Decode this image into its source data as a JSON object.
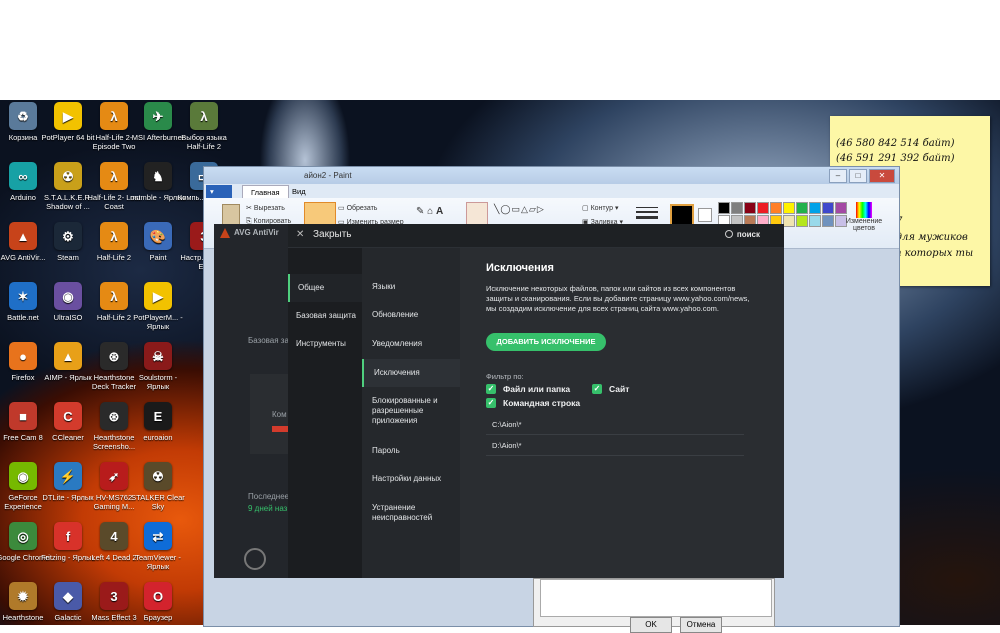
{
  "desktop": {
    "col1": [
      {
        "label": "Корзина",
        "icon": "recycle-bin-icon",
        "color": "#5a7a9a",
        "glyph": "♻"
      },
      {
        "label": "Arduino",
        "icon": "arduino-icon",
        "color": "#17a1a5",
        "glyph": "∞"
      },
      {
        "label": "AVG AntiVir...",
        "icon": "avg-icon",
        "color": "#c7431a",
        "glyph": "▲"
      },
      {
        "label": "Battle.net",
        "icon": "battlenet-icon",
        "color": "#1f6fc7",
        "glyph": "✶"
      },
      {
        "label": "Firefox",
        "icon": "firefox-icon",
        "color": "#e8731c",
        "glyph": "●"
      },
      {
        "label": "Free Cam 8",
        "icon": "freecam-icon",
        "color": "#c0392b",
        "glyph": "■"
      },
      {
        "label": "GeForce Experience",
        "icon": "geforce-icon",
        "color": "#76b900",
        "glyph": "◉"
      },
      {
        "label": "Google Chrome",
        "icon": "chrome-icon",
        "color": "#3c8a3c",
        "glyph": "◎"
      },
      {
        "label": "Hearthstone",
        "icon": "hearthstone-icon",
        "color": "#b07a2a",
        "glyph": "✹"
      }
    ],
    "col2": [
      {
        "label": "PotPlayer 64 bit",
        "icon": "potplayer-icon",
        "color": "#f2c200",
        "glyph": "▶"
      },
      {
        "label": "S.T.A.L.K.E.R. Shadow of ...",
        "icon": "stalker-icon",
        "color": "#c9a01a",
        "glyph": "☢"
      },
      {
        "label": "Steam",
        "icon": "steam-icon",
        "color": "#1b2838",
        "glyph": "⚙"
      },
      {
        "label": "UltraISO",
        "icon": "ultraiso-icon",
        "color": "#6a4fa0",
        "glyph": "◉"
      },
      {
        "label": "AIMP - Ярлык",
        "icon": "aimp-icon",
        "color": "#e8a018",
        "glyph": "▲"
      },
      {
        "label": "CCleaner",
        "icon": "ccleaner-icon",
        "color": "#d33b2c",
        "glyph": "C"
      },
      {
        "label": "DTLite - Ярлык",
        "icon": "dtlite-icon",
        "color": "#2a7ac2",
        "glyph": "⚡"
      },
      {
        "label": "Fritzing - Ярлык",
        "icon": "fritzing-icon",
        "color": "#d8322a",
        "glyph": "f"
      },
      {
        "label": "Galactic",
        "icon": "galactic-icon",
        "color": "#4a5aa8",
        "glyph": "◆"
      }
    ],
    "col3": [
      {
        "label": "Half-Life 2- Episode Two",
        "icon": "halflife-icon",
        "color": "#e58a14",
        "glyph": "λ"
      },
      {
        "label": "Half-Life 2- Lost Coast",
        "icon": "halflife-icon",
        "color": "#e58a14",
        "glyph": "λ"
      },
      {
        "label": "Half-Life 2",
        "icon": "halflife-icon",
        "color": "#e58a14",
        "glyph": "λ"
      },
      {
        "label": "Half-Life 2",
        "icon": "halflife-icon",
        "color": "#e58a14",
        "glyph": "λ"
      },
      {
        "label": "Hearthstone Deck Tracker",
        "icon": "deck-tracker-icon",
        "color": "#2a2a2a",
        "glyph": "⊛"
      },
      {
        "label": "Hearthstone Screensho...",
        "icon": "screenshot-icon",
        "color": "#2a2a2a",
        "glyph": "⊛"
      },
      {
        "label": "HV-MS762 Gaming M...",
        "icon": "mouse-icon",
        "color": "#b81c1c",
        "glyph": "➶"
      },
      {
        "label": "Left 4 Dead 2",
        "icon": "left4dead-icon",
        "color": "#5a4a2a",
        "glyph": "4"
      },
      {
        "label": "Mass Effect 3",
        "icon": "masseffect-icon",
        "color": "#9a1a1a",
        "glyph": "3"
      }
    ],
    "col4": [
      {
        "label": "MSI Afterburner",
        "icon": "afterburner-icon",
        "color": "#2a8a4a",
        "glyph": "✈"
      },
      {
        "label": "mumble - Ярлык",
        "icon": "mumble-icon",
        "color": "#222222",
        "glyph": "♞"
      },
      {
        "label": "Paint",
        "icon": "paint-icon",
        "color": "#3a6ab8",
        "glyph": "🎨"
      },
      {
        "label": "PotPlayerM... - Ярлык",
        "icon": "potplayer-icon",
        "color": "#f2c200",
        "glyph": "▶"
      },
      {
        "label": "Soulstorm - Ярлык",
        "icon": "soulstorm-icon",
        "color": "#8a1a1a",
        "glyph": "☠"
      },
      {
        "label": "euroaion",
        "icon": "euroaion-icon",
        "color": "#1a1a1a",
        "glyph": "E"
      },
      {
        "label": "STALKER Clear Sky",
        "icon": "stalker-icon",
        "color": "#5a4a2a",
        "glyph": "☢"
      },
      {
        "label": "TeamViewer - Ярлык",
        "icon": "teamviewer-icon",
        "color": "#0e6cd8",
        "glyph": "⇄"
      },
      {
        "label": "Браузер",
        "icon": "opera-icon",
        "color": "#d3232d",
        "glyph": "O"
      }
    ],
    "col5": [
      {
        "label": "Выбор языка Half-Life 2",
        "icon": "halflife-lang-icon",
        "color": "#5a7a3a",
        "glyph": "λ"
      },
      {
        "label": "Компь... Ярлык",
        "icon": "computer-icon",
        "color": "#3a6a9a",
        "glyph": "▭"
      },
      {
        "label": "Настр... Mass E...",
        "icon": "masseffect-config-icon",
        "color": "#9a1a1a",
        "glyph": "3"
      }
    ],
    "taskbar_over": [
      {
        "label": "Google Chrome",
        "icon": "chrome-icon",
        "color": "#3c8a3c",
        "glyph": "◎"
      },
      {
        "label": "Fritzing - Ярлык",
        "icon": "fritzing-icon",
        "color": "#d8322a",
        "glyph": "f"
      },
      {
        "label": "Left 4 Dead 2",
        "icon": "left4dead-icon",
        "color": "#5a4a2a",
        "glyph": "4"
      },
      {
        "label": "TeamViewer - Ярлык",
        "icon": "teamviewer-icon",
        "color": "#0e6cd8",
        "glyph": "⇄"
      }
    ]
  },
  "sticky_note": {
    "lines": [
      "(46 580 842 514 байт)",
      "(46 591 291 392 байт)",
      "7",
      "и для мужиков",
      "от которых ты"
    ]
  },
  "paint": {
    "title": "айон2 - Paint",
    "tabs": [
      "Главная",
      "Вид"
    ],
    "tools": {
      "cut": "Вырезать",
      "copy": "Копировать",
      "crop": "Обрезать",
      "resize": "Изменить размер",
      "outline": "Контур",
      "fill": "Заливка",
      "colors_edit": "Изменение цветов"
    },
    "palette": [
      "#000000",
      "#7f7f7f",
      "#880015",
      "#ed1c24",
      "#ff7f27",
      "#fff200",
      "#22b14c",
      "#00a2e8",
      "#3f48cc",
      "#a349a4",
      "#ffffff",
      "#c3c3c3",
      "#b97a57",
      "#ffaec9",
      "#ffc90e",
      "#efe4b0",
      "#b5e61d",
      "#99d9ea",
      "#7092be",
      "#c8bfe7"
    ],
    "dialog_buttons": [
      "OK",
      "Отмена"
    ]
  },
  "avg_background": {
    "title": "AVG AntiVir",
    "label1": "Базовая за",
    "label2": "Ком",
    "label3": "Последнее",
    "label4": "9 дней наз"
  },
  "avg": {
    "close_label": "Закрыть",
    "search_label": "поиск",
    "categories": [
      "Общее",
      "Базовая защита",
      "Инструменты"
    ],
    "subcategories": [
      "Языки",
      "Обновление",
      "Уведомления",
      "Исключения",
      "Блокированные и разрешенные приложения",
      "Пароль",
      "Настройки данных",
      "Устранение неисправностей"
    ],
    "content": {
      "title": "Исключения",
      "description": "Исключение некоторых файлов, папок или сайтов из всех компонентов защиты и сканирования. Если вы добавите страницу www.yahoo.com/news, мы создадим исключение для всех страниц сайта www.yahoo.com.",
      "add_button": "ДОБАВИТЬ ИСКЛЮЧЕНИЕ",
      "filter_label": "Фильтр по:",
      "filters": [
        "Файл или папка",
        "Сайт",
        "Командная строка"
      ],
      "exclusions": [
        "C:\\Aion\\*",
        "D:\\Aion\\*"
      ]
    },
    "colors": {
      "accent": "#36c06b",
      "bg": "#1e2124"
    }
  }
}
